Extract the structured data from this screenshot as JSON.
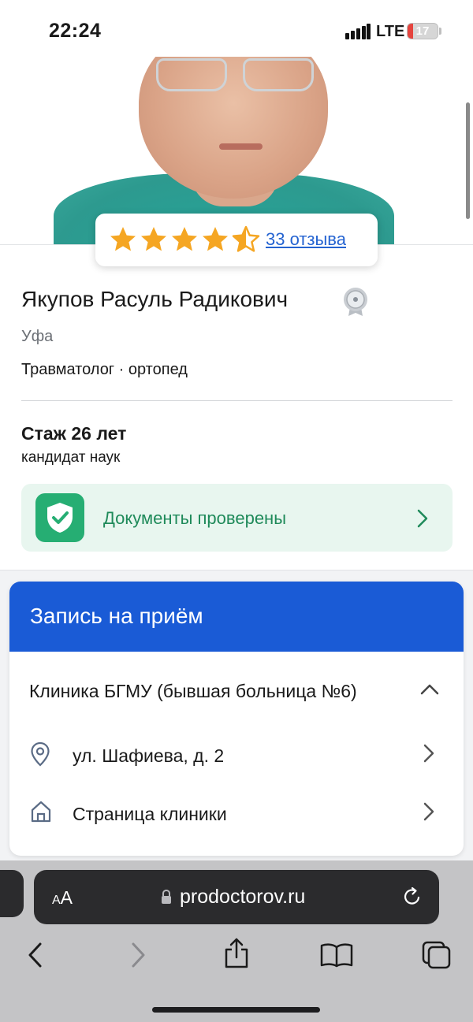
{
  "status_bar": {
    "time": "22:24",
    "network": "LTE",
    "battery_level": "17",
    "battery_color": "#e5443e"
  },
  "profile": {
    "photo_alt": "doctor-photo",
    "rating": {
      "stars": 4.5,
      "max_stars": 5,
      "star_color": "#f5a623",
      "reviews_link": "33 отзыва"
    },
    "name": "Якупов Расуль Радикович",
    "badge_icon": "medal-icon",
    "city": "Уфа",
    "specialty": "Травматолог · ортопед",
    "experience": "Стаж 26 лет",
    "degree": "кандидат наук",
    "documents": {
      "label": "Документы проверены",
      "icon": "shield-check-icon",
      "accent": "#26ae73"
    }
  },
  "appointment": {
    "title": "Запись на приём",
    "header_color": "#1a5bd6",
    "clinic_name": "Клиника БГМУ (бывшая больница №6)",
    "rows": [
      {
        "icon": "location-pin-icon",
        "label": "ул. Шафиева, д. 2"
      },
      {
        "icon": "home-icon",
        "label": "Страница клиники"
      }
    ]
  },
  "browser": {
    "aa_label": "AA",
    "url": "prodoctorov.ru"
  }
}
